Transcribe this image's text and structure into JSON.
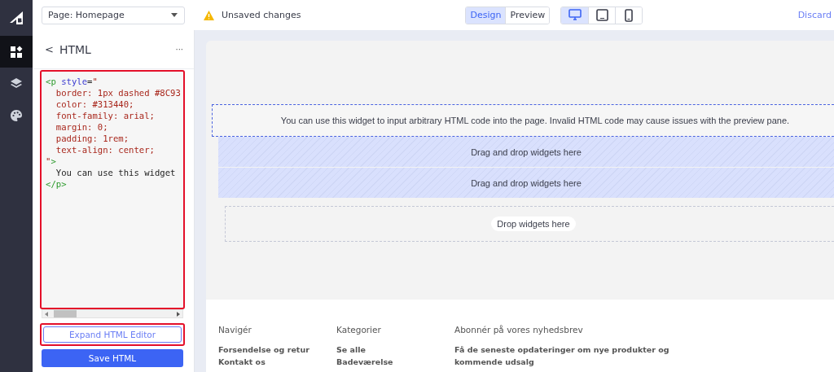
{
  "rail": {
    "items": [
      {
        "selected": true
      },
      {
        "selected": false
      },
      {
        "selected": false
      }
    ]
  },
  "topbar": {
    "page_select": "Page: Homepage",
    "warning": "Unsaved changes",
    "modes": [
      {
        "label": "Design",
        "selected": true
      },
      {
        "label": "Preview",
        "selected": false
      }
    ],
    "devices": [
      {
        "selected": true
      },
      {
        "selected": false
      },
      {
        "selected": false
      }
    ],
    "discard": "Discard"
  },
  "panel": {
    "back": "<",
    "title": "HTML",
    "more": "···",
    "code": [
      [
        {
          "kind": "tag",
          "text": "<p "
        },
        {
          "kind": "attr",
          "text": "style"
        },
        {
          "kind": "plain",
          "text": "="
        },
        {
          "kind": "value",
          "text": "\""
        }
      ],
      [
        {
          "kind": "value",
          "text": "  border: 1px dashed #8C93"
        }
      ],
      [
        {
          "kind": "value",
          "text": "  color: #313440;"
        }
      ],
      [
        {
          "kind": "value",
          "text": "  font-family: arial;"
        }
      ],
      [
        {
          "kind": "value",
          "text": "  margin: 0;"
        }
      ],
      [
        {
          "kind": "value",
          "text": "  padding: 1rem;"
        }
      ],
      [
        {
          "kind": "value",
          "text": "  text-align: center;"
        }
      ],
      [
        {
          "kind": "value",
          "text": "\""
        },
        {
          "kind": "tag",
          "text": ">"
        }
      ],
      [
        {
          "kind": "plain",
          "text": "  You can use this widget"
        }
      ],
      [
        {
          "kind": "tag",
          "text": "</p>"
        }
      ]
    ],
    "expand_button": "Expand HTML Editor",
    "save_button": "Save HTML"
  },
  "canvas": {
    "html_widget": "You can use this widget to input arbitrary HTML code into the page. Invalid HTML code may cause issues with the preview pane.",
    "drop_zones": [
      {
        "kind": "hatched",
        "label": "Drag and drop widgets here"
      },
      {
        "kind": "hatched",
        "label": "Drag and drop widgets here"
      },
      {
        "kind": "dashed",
        "label": "Drop widgets here"
      }
    ],
    "footer": [
      {
        "heading": "Navigér",
        "links": [
          "Forsendelse og retur",
          "Kontakt os"
        ]
      },
      {
        "heading": "Kategorier",
        "links": [
          "Se alle",
          "Badeværelse"
        ]
      },
      {
        "heading": "Abonnér på vores nyhedsbrev",
        "links": [
          "Få de seneste opdateringer om nye produkter og kommende udsalg"
        ]
      }
    ]
  }
}
